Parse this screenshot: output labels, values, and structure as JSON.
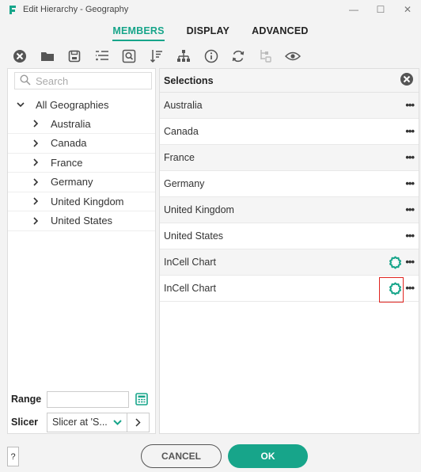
{
  "window": {
    "title": "Edit Hierarchy - Geography",
    "minimize": "—",
    "maximize": "☐",
    "close": "✕"
  },
  "tabs": [
    {
      "label": "MEMBERS",
      "active": true
    },
    {
      "label": "DISPLAY",
      "active": false
    },
    {
      "label": "ADVANCED",
      "active": false
    }
  ],
  "toolbar": {
    "icons": [
      "clear-icon",
      "folder-icon",
      "save-icon",
      "filter-list-icon",
      "search-zoom-icon",
      "sort-icon",
      "hierarchy-icon",
      "info-icon",
      "refresh-icon",
      "tree-disabled-icon",
      "eye-icon"
    ]
  },
  "left": {
    "search_placeholder": "Search",
    "tree": {
      "root": "All Geographies",
      "children": [
        "Australia",
        "Canada",
        "France",
        "Germany",
        "United Kingdom",
        "United States"
      ]
    },
    "range_label": "Range",
    "range_value": "",
    "slicer_label": "Slicer",
    "slicer_value": "Slicer at 'S..."
  },
  "right": {
    "header": "Selections",
    "rows": [
      {
        "label": "Australia",
        "gear": false,
        "highlight": false
      },
      {
        "label": "Canada",
        "gear": false,
        "highlight": false
      },
      {
        "label": "France",
        "gear": false,
        "highlight": false
      },
      {
        "label": "Germany",
        "gear": false,
        "highlight": false
      },
      {
        "label": "United Kingdom",
        "gear": false,
        "highlight": false
      },
      {
        "label": "United States",
        "gear": false,
        "highlight": false
      },
      {
        "label": "InCell Chart",
        "gear": true,
        "highlight": false
      },
      {
        "label": "InCell Chart",
        "gear": true,
        "highlight": true
      }
    ],
    "more_label": "•••"
  },
  "footer": {
    "help": "?",
    "cancel": "CANCEL",
    "ok": "OK"
  },
  "colors": {
    "accent": "#17a58a",
    "highlight": "#e0241f",
    "icon": "#555555"
  }
}
